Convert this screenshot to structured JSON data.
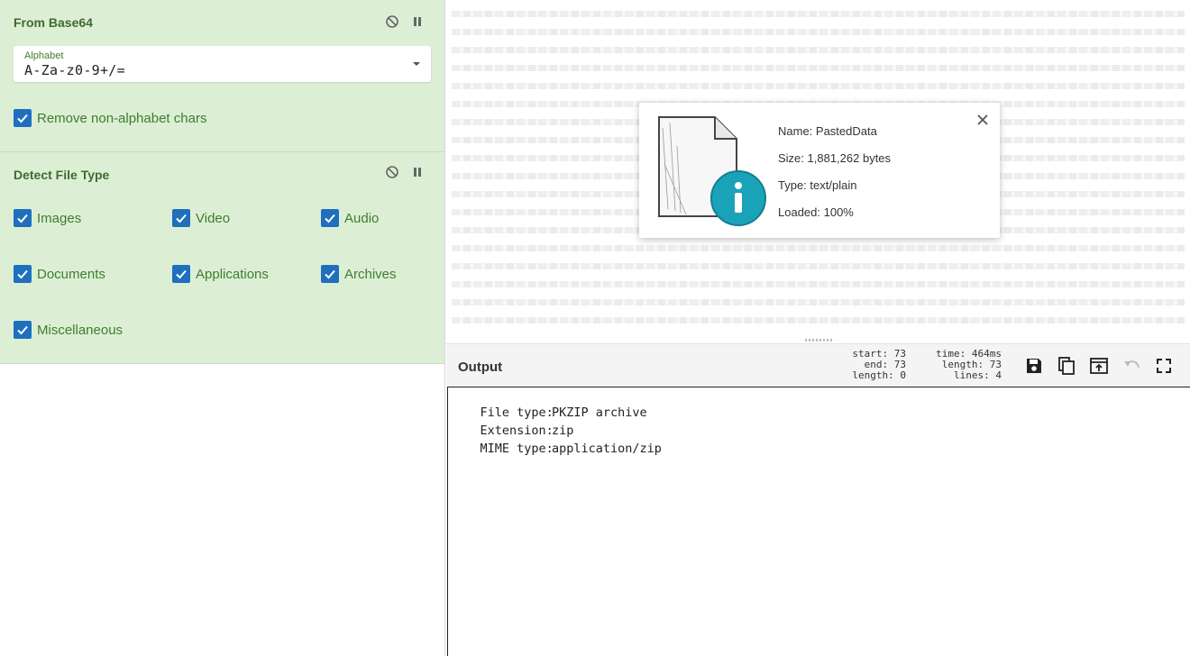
{
  "recipe": {
    "from_base64": {
      "title": "From Base64",
      "alphabet_label": "Alphabet",
      "alphabet_value": "A-Za-z0-9+/=",
      "remove_non_alphabet_label": "Remove non-alphabet chars",
      "remove_non_alphabet_checked": true
    },
    "detect_file_type": {
      "title": "Detect File Type",
      "options": [
        {
          "label": "Images",
          "checked": true
        },
        {
          "label": "Video",
          "checked": true
        },
        {
          "label": "Audio",
          "checked": true
        },
        {
          "label": "Documents",
          "checked": true
        },
        {
          "label": "Applications",
          "checked": true
        },
        {
          "label": "Archives",
          "checked": true
        },
        {
          "label": "Miscellaneous",
          "checked": true
        }
      ]
    },
    "op_icons": [
      "disable-icon",
      "pause-icon"
    ]
  },
  "file_info": {
    "name": "Name: PastedData",
    "size": "Size: 1,881,262 bytes",
    "type": "Type: text/plain",
    "loaded": "Loaded: 100%",
    "icons": [
      "file-info-illustration",
      "close-icon"
    ]
  },
  "output": {
    "title": "Output",
    "stats_left": [
      "start: 73",
      "end: 73",
      "length: 0"
    ],
    "stats_right": [
      "time: 464ms",
      "length: 73",
      "lines: 4"
    ],
    "toolbar_icons": [
      "save-icon",
      "copy-icon",
      "replace-input-icon",
      "undo-icon",
      "maximise-icon"
    ],
    "rows": [
      {
        "key": "File type:",
        "value": "PKZIP archive"
      },
      {
        "key": "Extension:",
        "value": "zip"
      },
      {
        "key": "MIME type:",
        "value": "application/zip"
      }
    ]
  },
  "colors": {
    "operation_bg": "#dcefd5",
    "operation_text": "#3f7d2e",
    "checkbox": "#1f6fbf",
    "popup_icon_teal": "#1aa3b8"
  }
}
